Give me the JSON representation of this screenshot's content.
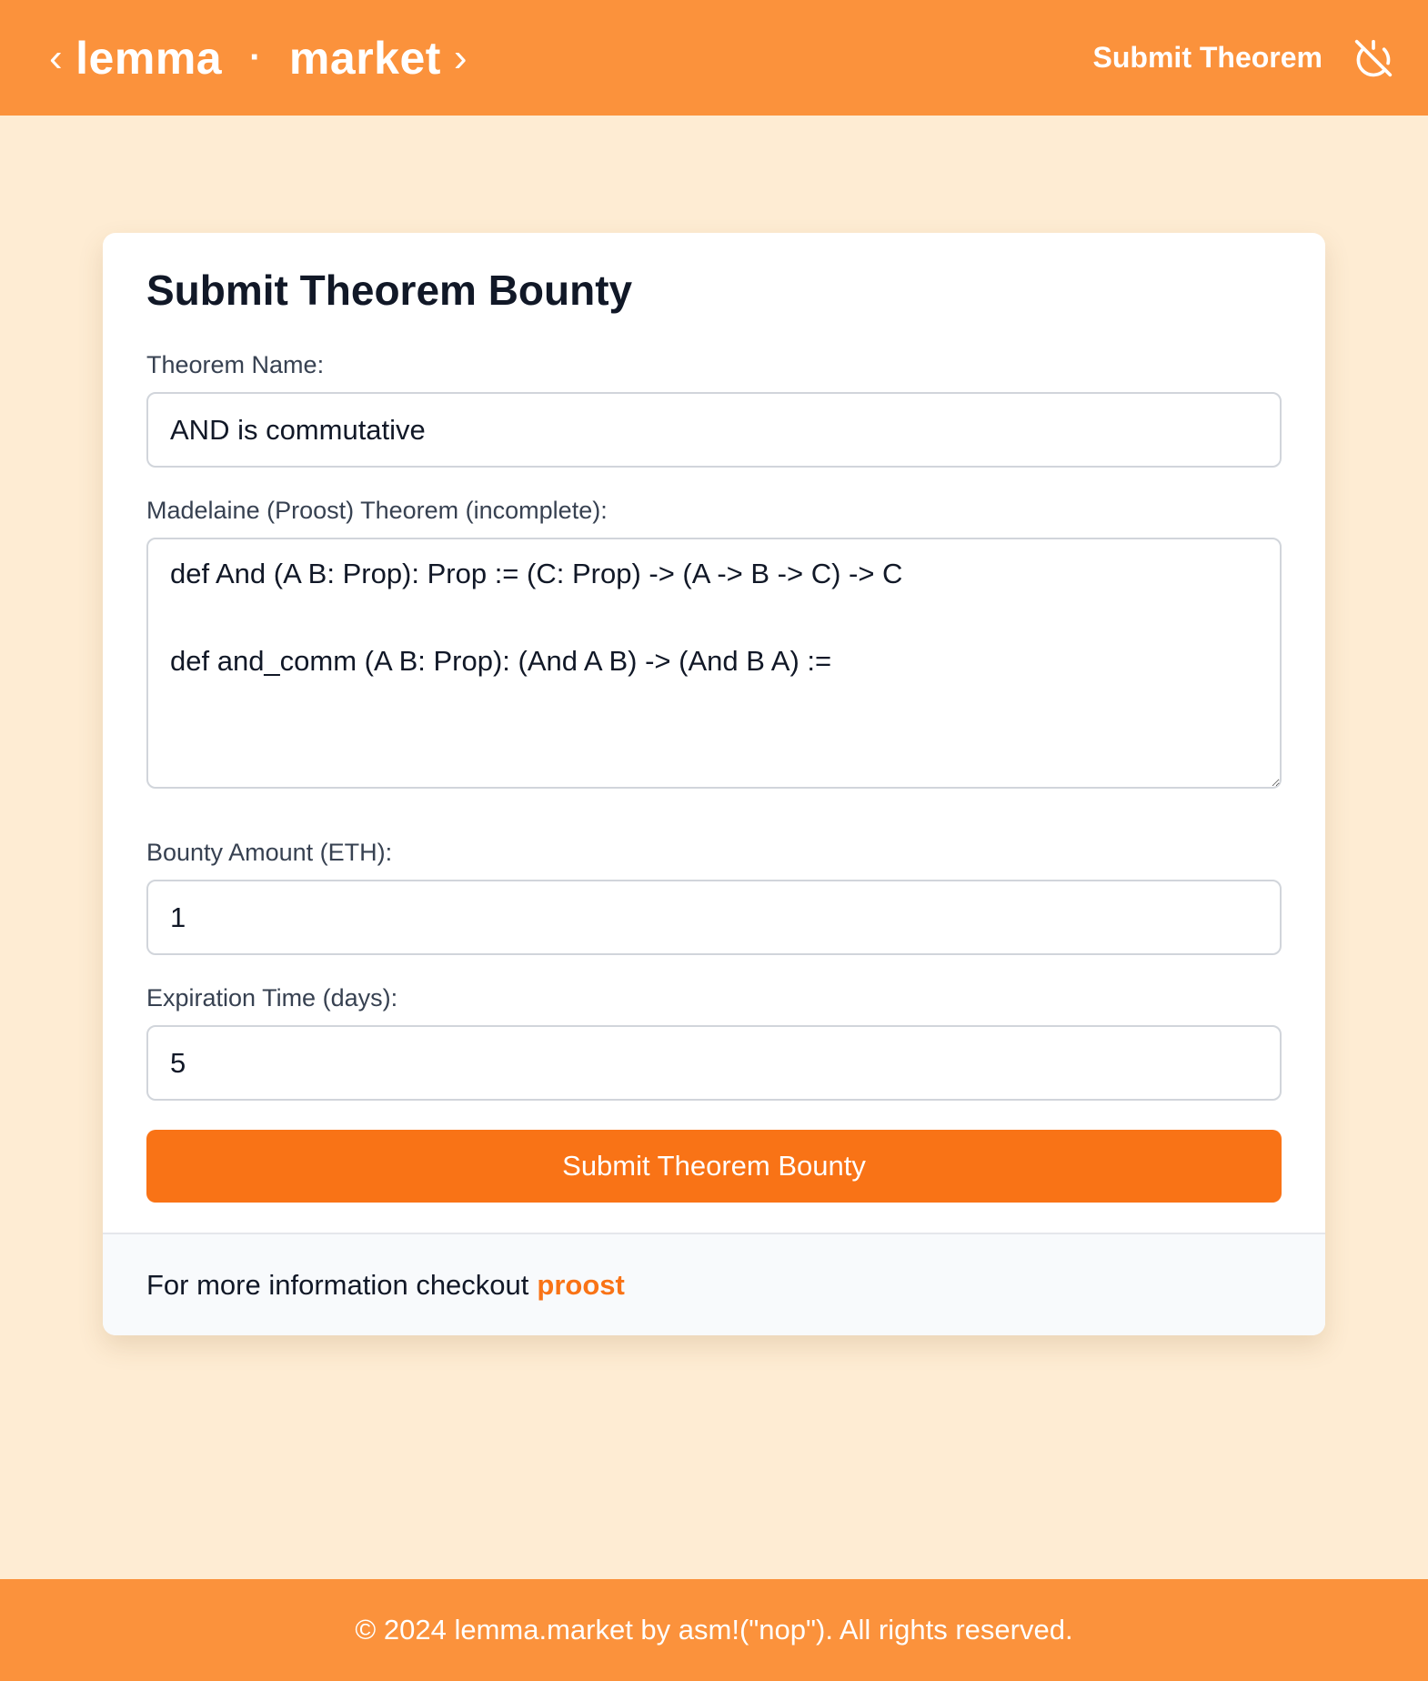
{
  "nav": {
    "brand_left": "lemma",
    "brand_separator": "·",
    "brand_right": "market",
    "prev_glyph": "‹",
    "next_glyph": "›",
    "submit_link": "Submit Theorem",
    "power_icon": "power-off-icon"
  },
  "form": {
    "title": "Submit Theorem Bounty",
    "theorem_name": {
      "label": "Theorem Name:",
      "value": "AND is commutative"
    },
    "theorem_code": {
      "label": "Madelaine (Proost) Theorem (incomplete):",
      "value": "def And (A B: Prop): Prop := (C: Prop) -> (A -> B -> C) -> C\n\ndef and_comm (A B: Prop): (And A B) -> (And B A) :="
    },
    "bounty": {
      "label": "Bounty Amount (ETH):",
      "value": "1"
    },
    "expiration": {
      "label": "Expiration Time (days):",
      "value": "5"
    },
    "submit_label": "Submit Theorem Bounty"
  },
  "card_footer": {
    "text": "For more information checkout",
    "link": "proost"
  },
  "page_footer": {
    "text": "© 2024 lemma.market by asm!(\"nop\"). All rights reserved."
  },
  "colors": {
    "header": "#fb923c",
    "page_bg": "#feecd3",
    "accent": "#f97316"
  }
}
